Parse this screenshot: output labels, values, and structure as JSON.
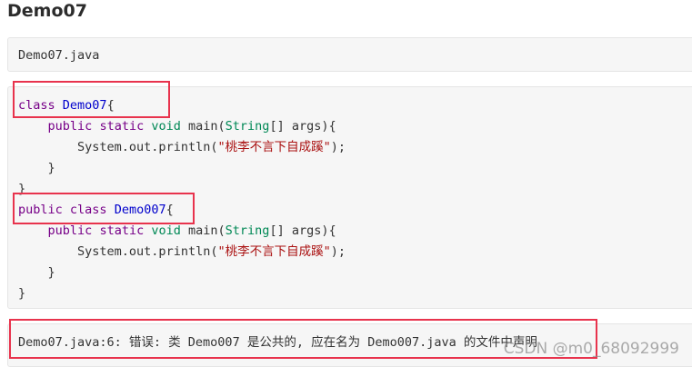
{
  "heading": "Demo07",
  "file_label": "Demo07.java",
  "code": {
    "l1_kw": "class",
    "l1_name": "Demo07",
    "l1_brace": "{",
    "l2_public": "public",
    "l2_static": "static",
    "l2_void": "void",
    "l2_main": "main(",
    "l2_type": "String",
    "l2_rest": "[] args){",
    "l3_call": "System.out.println(",
    "l3_str": "\"桃李不言下自成蹊\"",
    "l3_end": ");",
    "l4": "}",
    "l5": "}",
    "l6_public": "public",
    "l6_kw": "class",
    "l6_name": "Demo007",
    "l6_brace": "{",
    "l7_public": "public",
    "l7_static": "static",
    "l7_void": "void",
    "l7_main": "main(",
    "l7_type": "String",
    "l7_rest": "[] args){",
    "l8_call": "System.out.println(",
    "l8_str": "\"桃李不言下自成蹊\"",
    "l8_end": ");",
    "l9": "}",
    "l10": "}"
  },
  "error_message": "Demo07.java:6: 错误: 类 Demo007 是公共的, 应在名为 Demo007.java 的文件中声明",
  "watermark": "CSDN @m0_68092999",
  "colors": {
    "keyword": "#770088",
    "class_name": "#0000cc",
    "type": "#008855",
    "string": "#aa1111",
    "highlight_border": "#e8334d",
    "code_background": "#f6f6f6"
  }
}
